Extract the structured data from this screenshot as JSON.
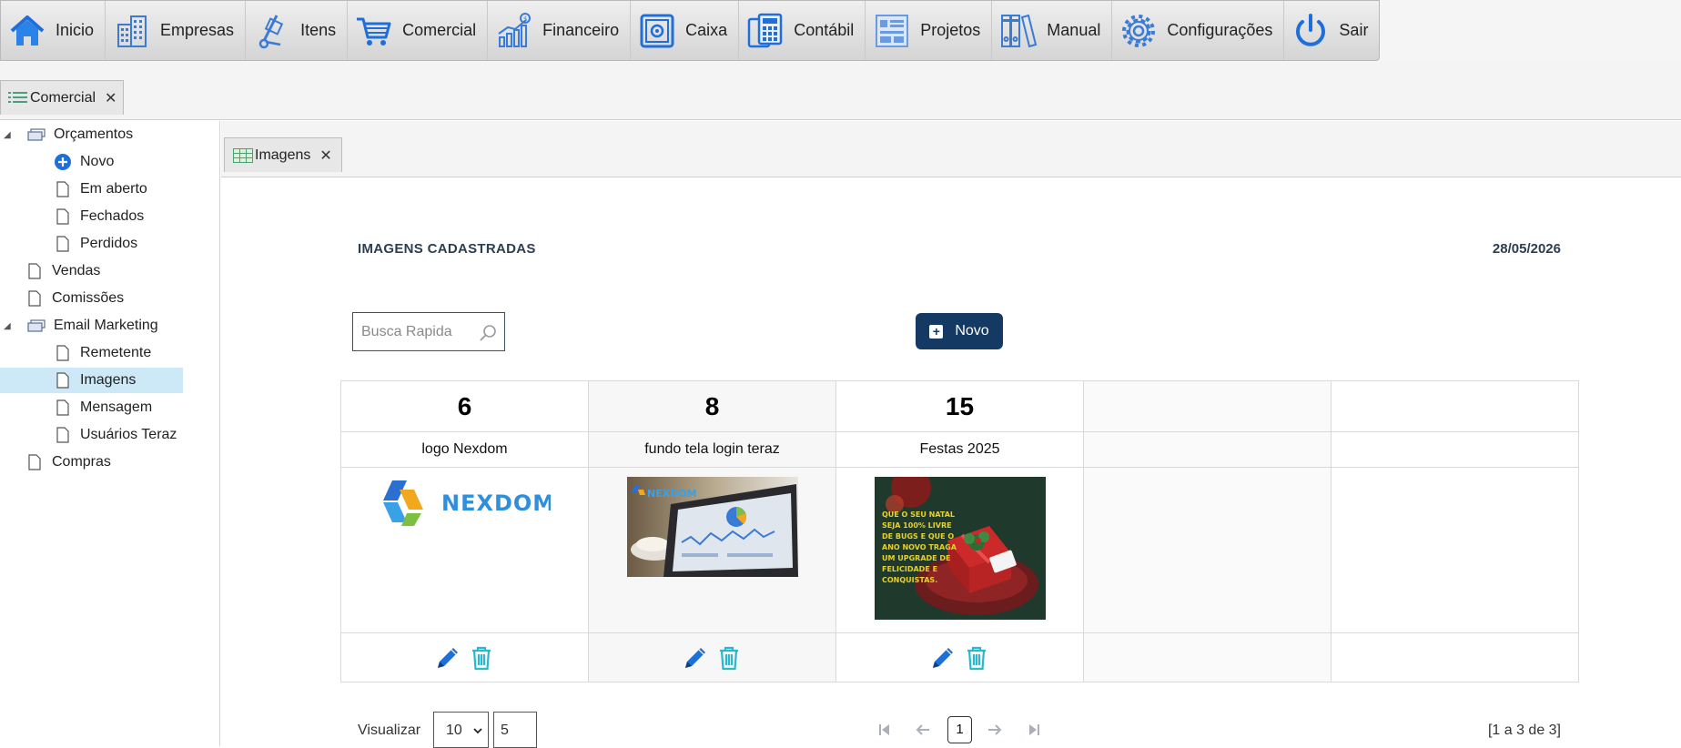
{
  "menu": [
    {
      "label": "Inicio",
      "icon": "home-icon"
    },
    {
      "label": "Empresas",
      "icon": "buildings-icon"
    },
    {
      "label": "Itens",
      "icon": "hand-truck-icon"
    },
    {
      "label": "Comercial",
      "icon": "shopping-cart-icon"
    },
    {
      "label": "Financeiro",
      "icon": "growth-chart-icon"
    },
    {
      "label": "Caixa",
      "icon": "safe-icon"
    },
    {
      "label": "Contábil",
      "icon": "calculator-icon"
    },
    {
      "label": "Projetos",
      "icon": "blueprint-icon"
    },
    {
      "label": "Manual",
      "icon": "binders-icon"
    },
    {
      "label": "Configurações",
      "icon": "gear-icon"
    },
    {
      "label": "Sair",
      "icon": "power-icon"
    }
  ],
  "module_tab": {
    "label": "Comercial",
    "close": "✕"
  },
  "sidebar": {
    "items": [
      {
        "label": "Orçamentos"
      },
      {
        "label": "Novo"
      },
      {
        "label": "Em aberto"
      },
      {
        "label": "Fechados"
      },
      {
        "label": "Perdidos"
      },
      {
        "label": "Vendas"
      },
      {
        "label": "Comissões"
      },
      {
        "label": "Email Marketing"
      },
      {
        "label": "Remetente"
      },
      {
        "label": "Imagens"
      },
      {
        "label": "Mensagem"
      },
      {
        "label": "Usuários Teraz"
      },
      {
        "label": "Compras"
      }
    ],
    "selected": "Imagens"
  },
  "sub_tab": {
    "label": "Imagens",
    "close": "✕"
  },
  "page": {
    "title": "IMAGENS CADASTRADAS",
    "date": "28/05/2026"
  },
  "search": {
    "placeholder": "Busca Rapida"
  },
  "toolbar": {
    "novo_label": "Novo",
    "novo_icon": "plus-square-icon"
  },
  "images": [
    {
      "id": "6",
      "name": "logo Nexdom",
      "logo_text": "NEXDOM"
    },
    {
      "id": "8",
      "name": "fundo tela login teraz",
      "logo_text": "NEXDOM"
    },
    {
      "id": "15",
      "name": "Festas 2025",
      "card_lines": [
        "QUE O SEU NATAL",
        "SEJA 100% LIVRE",
        "DE BUGS E QUE O",
        "ANO NOVO TRAGA",
        "UM UPGRADE DE",
        "FELICIDADE E",
        "CONQUISTAS."
      ]
    }
  ],
  "pager": {
    "label": "Visualizar",
    "page_size": "10",
    "page_input": "5",
    "current_page": "1",
    "info": "[1 a 3 de 3]"
  },
  "colors": {
    "accent": "#143a63",
    "icon_blue": "#1e6fd9",
    "trash_cyan": "#2bb7d0",
    "selected_row": "#cde8f6"
  }
}
